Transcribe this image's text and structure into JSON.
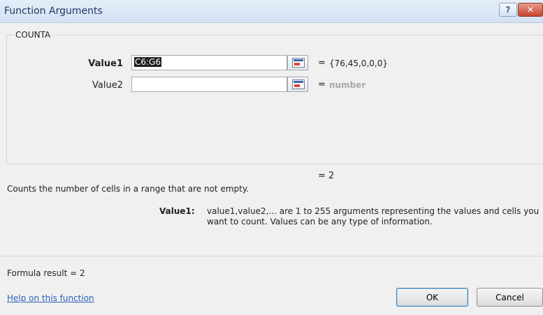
{
  "window": {
    "title": "Function Arguments",
    "help_glyph": "?",
    "close_glyph": "✕"
  },
  "function": {
    "name": "COUNTA",
    "result": "= 2",
    "description": "Counts the number of cells in a range that are not empty.",
    "help_heading": "Value1:",
    "help_text": "value1,value2,... are 1 to 255 arguments representing the values and cells you want to count. Values can be any type of information."
  },
  "arguments": [
    {
      "label": "Value1",
      "value": "C6:G6",
      "equals": "=",
      "evaluated": "{76,45,0,0,0}"
    },
    {
      "label": "Value2",
      "value": "",
      "equals": "=",
      "evaluated": "number"
    }
  ],
  "footer": {
    "formula_result": "Formula result =  2",
    "help_link": "Help on this function",
    "ok_label": "OK",
    "cancel_label": "Cancel"
  },
  "icons": {
    "collapse_dialog": "range-select-icon",
    "help": "help-icon",
    "close": "close-icon"
  },
  "colors": {
    "title_bar": "#d3e1f2",
    "close_button": "#c4452c",
    "link": "#2a62b9"
  }
}
